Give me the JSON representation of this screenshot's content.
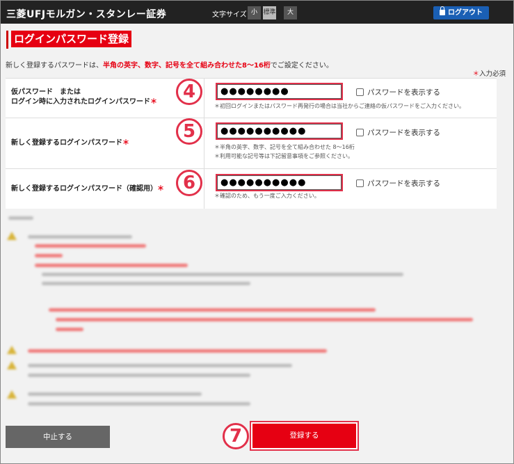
{
  "header": {
    "brand": "三菱UFJモルガン・スタンレー証券",
    "font_size_label": "文字サイズ",
    "font_size_options": [
      "小",
      "標準",
      "大"
    ],
    "font_size_selected": "標準",
    "logout_label": "ログアウト"
  },
  "page": {
    "title": "ログインパスワード登録",
    "intro_before": "新しく登録するパスワードは、",
    "intro_highlight": "半角の英字、数字、記号を全て組み合わせた8～16桁",
    "intro_after": "でご設定ください。",
    "required_mark": "＊",
    "required_note": "入力必須"
  },
  "form": {
    "rows": [
      {
        "label_line1": "仮パスワード　または",
        "label_line2": "ログイン時に入力されたログインパスワード",
        "value": "●●●●●●●●",
        "show_label": "パスワードを表示する",
        "hints": [
          "＊初回ログインまたはパスワード再発行の場合は当社からご連絡の仮パスワードをご入力ください。"
        ],
        "step": "4"
      },
      {
        "label_line1": "新しく登録するログインパスワード",
        "value": "●●●●●●●●●●",
        "show_label": "パスワードを表示する",
        "hints": [
          "＊半角の英字、数字、記号を全て組み合わせた 8～16桁",
          "＊利用可能な記号等は下記留意事項をご参照ください。"
        ],
        "step": "5"
      },
      {
        "label_line1": "新しく登録するログインパスワード（確認用）",
        "value": "●●●●●●●●●●",
        "show_label": "パスワードを表示する",
        "hints": [
          "＊確認のため、もう一度ご入力ください。"
        ],
        "step": "6"
      }
    ]
  },
  "buttons": {
    "cancel": "中止する",
    "submit": "登録する",
    "submit_step": "7"
  },
  "colors": {
    "brand_red": "#e60012",
    "highlight_border": "#e2304a",
    "header_bg": "#222222",
    "logout_blue": "#1a5fb4"
  }
}
